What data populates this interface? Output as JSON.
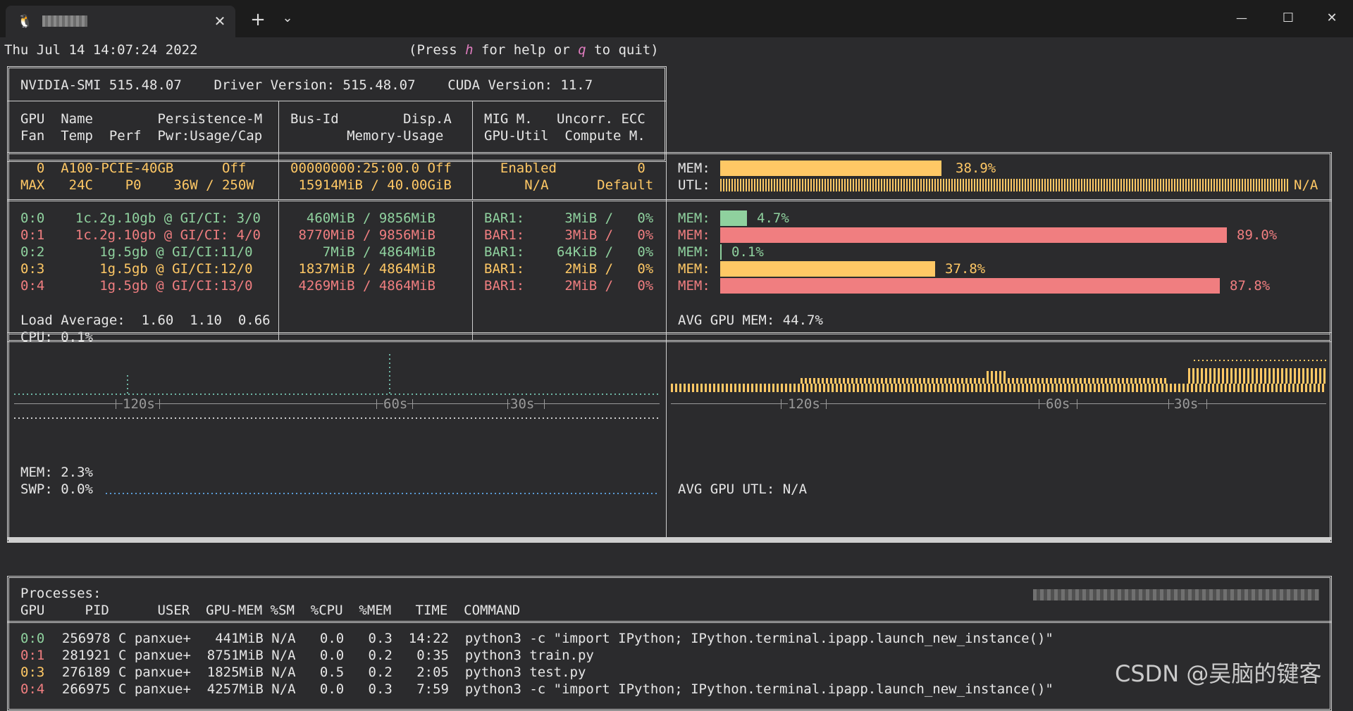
{
  "window": {
    "tab_title": "",
    "new_tab": "+",
    "dropdown": "⌄",
    "minimize": "—",
    "maximize": "☐",
    "close": "✕",
    "tab_close": "✕",
    "os_icon": "linux-tux-icon"
  },
  "header": {
    "datetime": "Thu Jul 14 14:07:24 2022",
    "help_prefix": "(Press ",
    "help_key_h": "h",
    "help_mid": " for help or ",
    "help_key_q": "q",
    "help_suffix": " to quit)"
  },
  "smi": {
    "version_line": "NVIDIA-SMI 515.48.07    Driver Version: 515.48.07    CUDA Version: 11.7",
    "col1_h1": "GPU  Name        Persistence-M",
    "col1_h2": "Fan  Temp  Perf  Pwr:Usage/Cap",
    "col2_h1": "Bus-Id        Disp.A",
    "col2_h2": "       Memory-Usage",
    "col3_h1": "MIG M.   Uncorr. ECC",
    "col3_h2": "GPU-Util  Compute M."
  },
  "gpu": {
    "line1_col1": "  0  A100-PCIE-40GB      Off",
    "line2_col1": "MAX   24C    P0    36W / 250W",
    "line1_col2": "00000000:25:00.0 Off",
    "line2_col2": " 15914MiB / 40.00GiB",
    "line1_col3": "  Enabled          0",
    "line2_col3": "     N/A      Default",
    "mem_label": "MEM:",
    "mem_pct": "38.9%",
    "mem_value": 0.389,
    "utl_label": "UTL:",
    "utl_value": "N/A"
  },
  "mig": [
    {
      "id": "0:0",
      "profile": "  1c.2g.10gb @ GI/CI: 3/0",
      "mem": "  460MiB / 9856MiB",
      "bar1": "BAR1:     3MiB /   0%",
      "mem_label": "MEM:",
      "pct": "4.7%",
      "value": 0.047,
      "color": "#8fd19e"
    },
    {
      "id": "0:1",
      "profile": "  1c.2g.10gb @ GI/CI: 4/0",
      "mem": " 8770MiB / 9856MiB",
      "bar1": "BAR1:     3MiB /   0%",
      "mem_label": "MEM:",
      "pct": "89.0%",
      "value": 0.89,
      "color": "#f07e80"
    },
    {
      "id": "0:2",
      "profile": "     1g.5gb @ GI/CI:11/0",
      "mem": "    7MiB / 4864MiB",
      "bar1": "BAR1:    64KiB /   0%",
      "mem_label": "MEM:",
      "pct": "0.1%",
      "value": 0.001,
      "color": "#8fd19e"
    },
    {
      "id": "0:3",
      "profile": "     1g.5gb @ GI/CI:12/0",
      "mem": " 1837MiB / 4864MiB",
      "bar1": "BAR1:     2MiB /   0%",
      "mem_label": "MEM:",
      "pct": "37.8%",
      "value": 0.378,
      "color": "#ffc865"
    },
    {
      "id": "0:4",
      "profile": "     1g.5gb @ GI/CI:13/0",
      "mem": " 4269MiB / 4864MiB",
      "bar1": "BAR1:     2MiB /   0%",
      "mem_label": "MEM:",
      "pct": "87.8%",
      "value": 0.878,
      "color": "#f07e80"
    }
  ],
  "host": {
    "load_average": "Load Average:  1.60  1.10  0.66",
    "cpu": "CPU: 0.1%",
    "mem": "MEM: 2.3%",
    "swp": "SWP: 0.0%",
    "tick_120": "120s",
    "tick_60": "60s",
    "tick_30": "30s"
  },
  "gpu_avg": {
    "mem": "AVG GPU MEM: 44.7%",
    "utl": "AVG GPU UTL: N/A",
    "tick_120": "120s",
    "tick_60": "60s",
    "tick_30": "30s"
  },
  "processes": {
    "title": "Processes:",
    "header": "GPU     PID      USER  GPU-MEM %SM  %CPU  %MEM   TIME  COMMAND",
    "rows": [
      {
        "gpu": "0:0",
        "rest": "  256978 C panxue+   441MiB N/A   0.0   0.3  14:22  python3 -c \"import IPython; IPython.terminal.ipapp.launch_new_instance()\"",
        "color": "#8fd19e"
      },
      {
        "gpu": "0:1",
        "rest": "  281921 C panxue+  8751MiB N/A   0.0   0.2   0:35  python3 train.py",
        "color": "#f07e80"
      },
      {
        "gpu": "0:3",
        "rest": "  276189 C panxue+  1825MiB N/A   0.5   0.2   2:05  python3 test.py",
        "color": "#ffc865"
      },
      {
        "gpu": "0:4",
        "rest": "  266975 C panxue+  4257MiB N/A   0.0   0.3   7:59  python3 -c \"import IPython; IPython.terminal.ipapp.launch_new_instance()\"",
        "color": "#f07e80"
      }
    ]
  },
  "watermark": "CSDN @吴脑的键客"
}
